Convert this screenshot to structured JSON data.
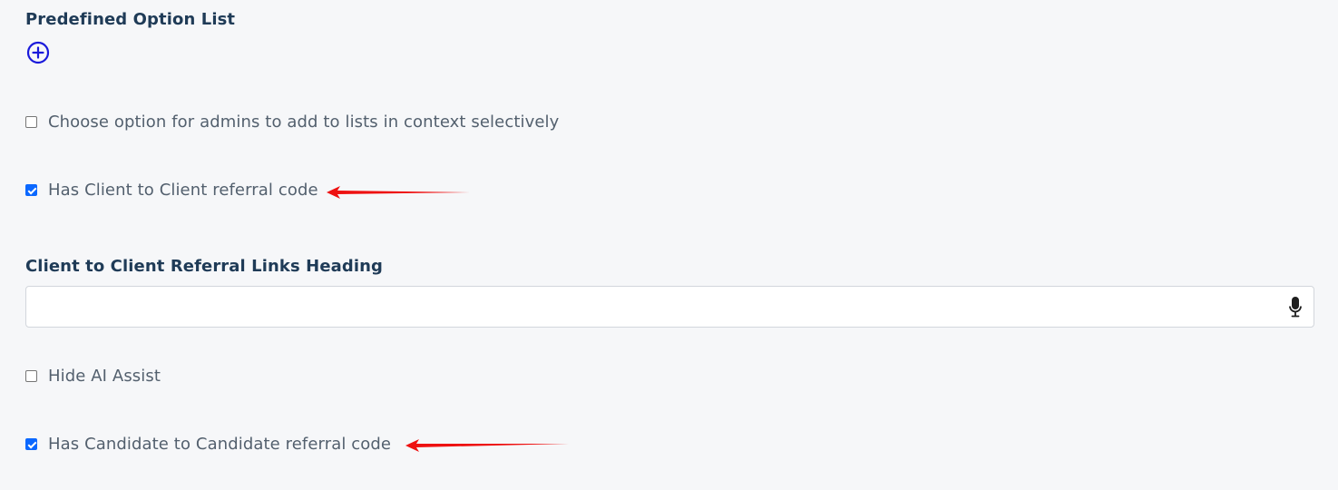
{
  "predefined_option_list": {
    "heading": "Predefined Option List",
    "add_icon": "plus-circle-icon"
  },
  "options": {
    "choose_option_selectively": {
      "label": "Choose option for admins to add to lists in context selectively",
      "checked": false
    },
    "has_client_referral_code": {
      "label": "Has Client to Client referral code",
      "checked": true
    },
    "hide_ai_assist": {
      "label": "Hide AI Assist",
      "checked": false
    },
    "has_candidate_referral_code": {
      "label": "Has Candidate to Candidate referral code",
      "checked": true
    }
  },
  "client_referral_heading": {
    "label": "Client to Client Referral Links Heading",
    "value": "",
    "mic_icon": "microphone-icon"
  },
  "annotations": {
    "arrow_color": "#ee1111"
  },
  "colors": {
    "heading": "#1f3b57",
    "checkbox_checked": "#0b68ff",
    "add_icon": "#1a1adb",
    "background": "#f6f7f9"
  }
}
